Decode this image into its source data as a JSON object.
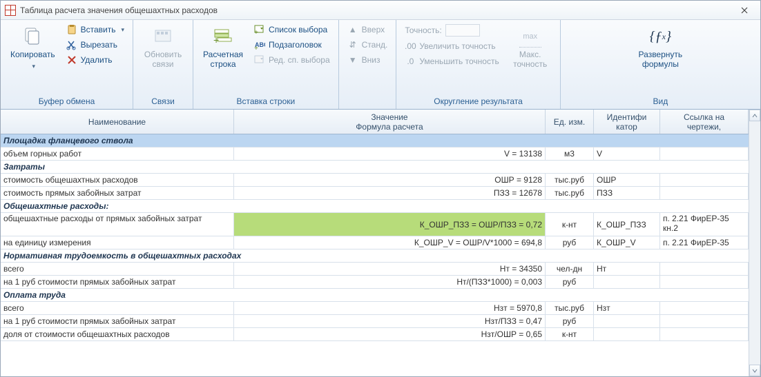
{
  "window": {
    "title": "Таблица расчета значения общешахтных расходов"
  },
  "ribbon": {
    "clipboard": {
      "label": "Буфер обмена",
      "copy": "Копировать",
      "paste": "Вставить",
      "cut": "Вырезать",
      "delete": "Удалить"
    },
    "links": {
      "label": "Связи",
      "update_links": "Обновить\nсвязи"
    },
    "insert_row": {
      "label": "Вставка строки",
      "calc_row": "Расчетная\nстрока",
      "choice_list": "Список выбора",
      "subheader": "Подзаголовок",
      "edit_choice": "Ред. сп. выбора"
    },
    "moves": {
      "up": "Вверх",
      "std": "Станд.",
      "down": "Вниз"
    },
    "rounding": {
      "label": "Округление результата",
      "precision": "Точность:",
      "inc": "Увеличить точность",
      "dec": "Уменьшить точность",
      "max_icon": "max",
      "max": "Макс.\nточность"
    },
    "view": {
      "label": "Вид",
      "expand": "Развернуть\nформулы"
    }
  },
  "columns": {
    "name": "Наименование",
    "value": "Значение\nФормула расчета",
    "unit": "Ед. изм.",
    "id": "Идентифи\nкатор",
    "ref": "Ссылка на\nчертежи,"
  },
  "sections": {
    "s1": "Площадка фланцевого ствола",
    "s2": "Затраты",
    "s3": "Общешахтные расходы:",
    "s4": "Нормативная трудоемкость в общешахтных расходах",
    "s5": "Оплата труда"
  },
  "rows": {
    "r1": {
      "name": "объем горных работ",
      "value": "V = 13138",
      "unit": "м3",
      "id": "V",
      "ref": ""
    },
    "r2": {
      "name": "стоимость общешахтных расходов",
      "value": "ОШР = 9128",
      "unit": "тыс.руб",
      "id": "ОШР",
      "ref": ""
    },
    "r3": {
      "name": "стоимость прямых забойных затрат",
      "value": "ПЗЗ = 12678",
      "unit": "тыс.руб",
      "id": "ПЗЗ",
      "ref": ""
    },
    "r4": {
      "name": "общешахтные расходы от прямых забойных затрат",
      "value": "К_ОШР_ПЗЗ = ОШР/ПЗЗ = 0,72",
      "unit": "к-нт",
      "id": "К_ОШР_ПЗЗ",
      "ref": "п. 2.21 ФирЕР-35 кн.2"
    },
    "r5": {
      "name": "на единицу измерения",
      "value": "К_ОШР_V = ОШР/V*1000 = 694,8",
      "unit": "руб",
      "id": "К_ОШР_V",
      "ref": "п. 2.21 ФирЕР-35"
    },
    "r6": {
      "name": "всего",
      "value": "Нт = 34350",
      "unit": "чел-дн",
      "id": "Нт",
      "ref": ""
    },
    "r7": {
      "name": "на 1 руб стоимости прямых забойных затрат",
      "value": "Нт/(ПЗЗ*1000) = 0,003",
      "unit": "руб",
      "id": "",
      "ref": ""
    },
    "r8": {
      "name": "всего",
      "value": "Нзт = 5970,8",
      "unit": "тыс.руб",
      "id": "Нзт",
      "ref": ""
    },
    "r9": {
      "name": "на 1 руб стоимости прямых забойных затрат",
      "value": "Нзт/ПЗЗ = 0,47",
      "unit": "руб",
      "id": "",
      "ref": ""
    },
    "r10": {
      "name": "доля от стоимости общешахтных расходов",
      "value": "Нзт/ОШР = 0,65",
      "unit": "к-нт",
      "id": "",
      "ref": ""
    }
  }
}
